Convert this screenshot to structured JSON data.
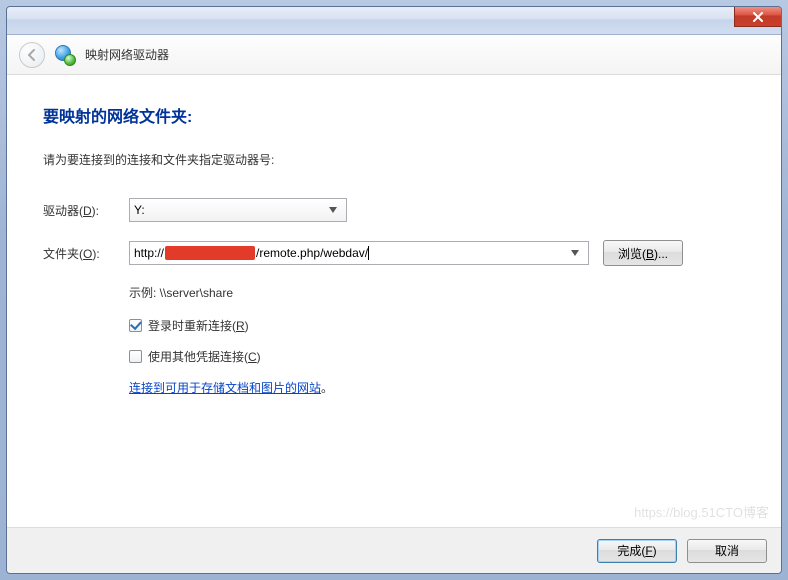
{
  "header": {
    "title": "映射网络驱动器"
  },
  "content": {
    "heading": "要映射的网络文件夹:",
    "instruction": "请为要连接到的连接和文件夹指定驱动器号:",
    "drive": {
      "label_pre": "驱动器(",
      "label_key": "D",
      "label_post": "):",
      "value": "Y:"
    },
    "folder": {
      "label_pre": "文件夹(",
      "label_key": "O",
      "label_post": "):",
      "value_prefix": "http://",
      "value_suffix": "/remote.php/webdav/"
    },
    "browse": {
      "label_pre": "浏览(",
      "label_key": "B",
      "label_post": ")..."
    },
    "example": "示例: \\\\server\\share",
    "reconnect": {
      "checked": true,
      "label_pre": "登录时重新连接(",
      "label_key": "R",
      "label_post": ")"
    },
    "othercreds": {
      "checked": false,
      "label_pre": "使用其他凭据连接(",
      "label_key": "C",
      "label_post": ")"
    },
    "link": {
      "text": "连接到可用于存储文档和图片的网站",
      "period": "。"
    }
  },
  "footer": {
    "finish": {
      "label_pre": "完成(",
      "label_key": "F",
      "label_post": ")"
    },
    "cancel": "取消"
  },
  "watermark": "https://blog.51CTO博客"
}
